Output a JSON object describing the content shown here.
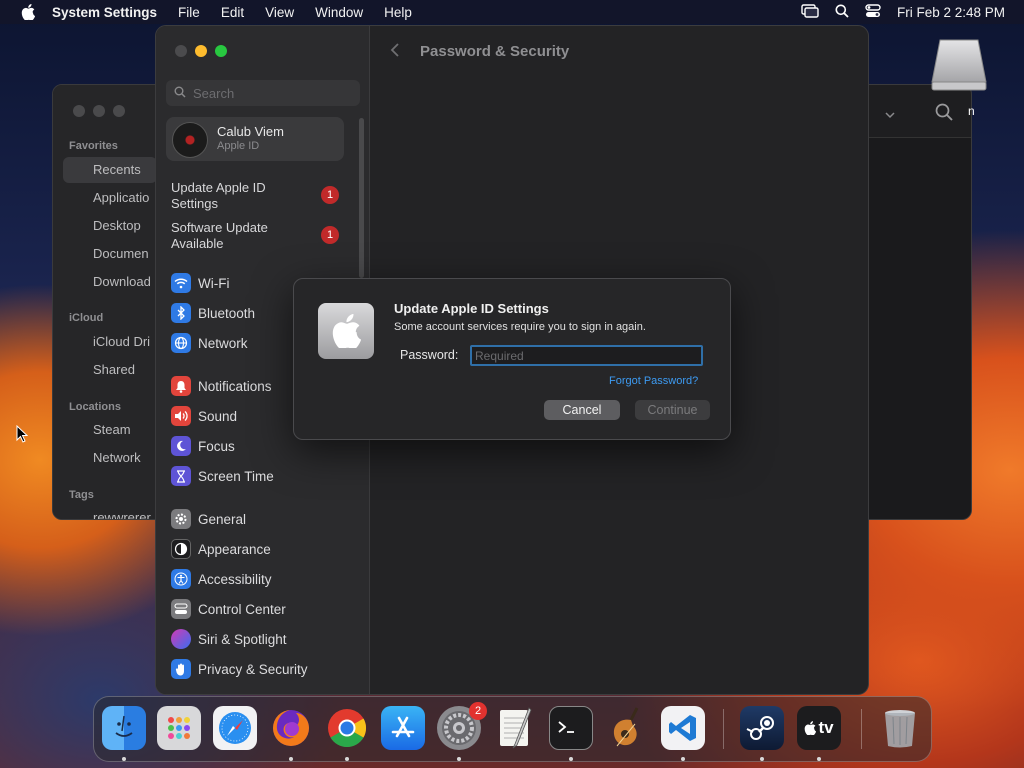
{
  "menubar": {
    "app_name": "System Settings",
    "items": [
      "File",
      "Edit",
      "View",
      "Window",
      "Help"
    ],
    "clock": "Fri Feb 2  2:48 PM"
  },
  "finder": {
    "sections": {
      "favorites": "Favorites",
      "icloud": "iCloud",
      "locations": "Locations",
      "tags": "Tags"
    },
    "items": {
      "recents": "Recents",
      "applications": "Applicatio",
      "desktop": "Desktop",
      "documents": "Documen",
      "downloads": "Download",
      "icloud_drive": "iCloud Dri",
      "shared": "Shared",
      "steam": "Steam",
      "network": "Network",
      "tag": "rewwrerer"
    }
  },
  "drive": {
    "label": "n"
  },
  "settings": {
    "search_placeholder": "Search",
    "account": {
      "name": "Calub Viem",
      "sub": "Apple ID"
    },
    "notices": [
      {
        "label": "Update Apple ID Settings",
        "badge": "1"
      },
      {
        "label": "Software Update Available",
        "badge": "1"
      }
    ],
    "nav": {
      "wifi": "Wi-Fi",
      "bluetooth": "Bluetooth",
      "network": "Network",
      "notifications": "Notifications",
      "sound": "Sound",
      "focus": "Focus",
      "screen_time": "Screen Time",
      "general": "General",
      "appearance": "Appearance",
      "accessibility": "Accessibility",
      "control_center": "Control Center",
      "siri": "Siri & Spotlight",
      "privacy": "Privacy & Security"
    },
    "page_title": "Password & Security"
  },
  "dialog": {
    "title": "Update Apple ID Settings",
    "message": "Some account services require you to sign in again.",
    "password_label": "Password:",
    "password_placeholder": "Required",
    "forgot": "Forgot Password?",
    "cancel": "Cancel",
    "continue": "Continue"
  },
  "dock": {
    "settings_badge": "2",
    "tv_label": "tv"
  },
  "colors": {
    "accent": "#3d9bf2",
    "badge": "#c12a2a",
    "close": "#ff5f57",
    "minimize": "#febc2e",
    "zoom": "#28c840"
  }
}
